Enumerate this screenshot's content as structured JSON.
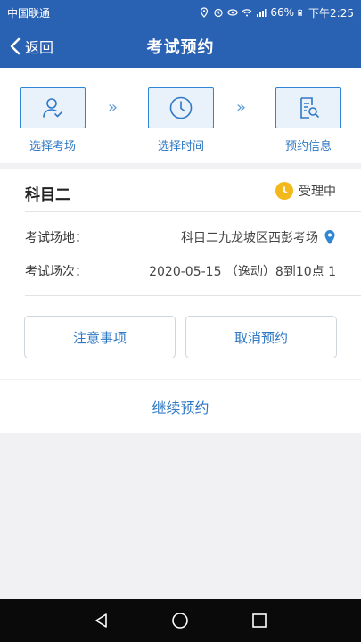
{
  "status_bar": {
    "carrier": "中国联通",
    "battery": "66%",
    "time": "下午2:25"
  },
  "header": {
    "back_label": "返回",
    "title": "考试预约"
  },
  "steps": [
    {
      "label": "选择考场",
      "icon": "user-check-icon"
    },
    {
      "label": "选择时间",
      "icon": "clock-icon"
    },
    {
      "label": "预约信息",
      "icon": "document-search-icon"
    }
  ],
  "step_arrow": "»",
  "booking": {
    "subject": "科目二",
    "status": "受理中",
    "venue_label": "考试场地：",
    "venue_value": "科目二九龙坡区西彭考场",
    "session_label": "考试场次：",
    "session_value": "2020-05-15 （逸动）8到10点 1"
  },
  "buttons": {
    "notice": "注意事项",
    "cancel": "取消预约",
    "continue": "继续预约"
  },
  "colors": {
    "primary": "#2a62b3",
    "accent": "#2f78c4",
    "status_badge": "#f3b81b"
  }
}
